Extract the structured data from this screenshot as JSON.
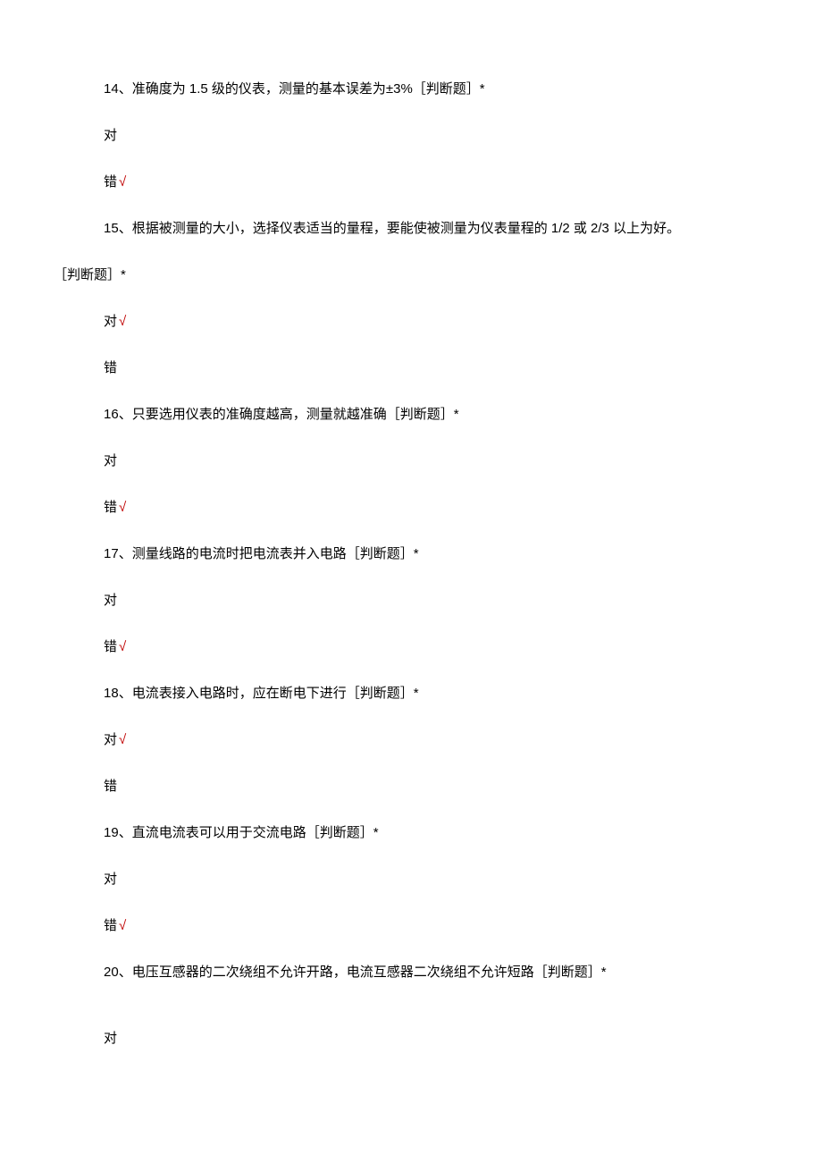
{
  "questions": [
    {
      "number": "14",
      "text": "、准确度为 1.5 级的仪表，测量的基本误差为±3%［判断题］*",
      "options": [
        {
          "label": "对",
          "correct": false
        },
        {
          "label": "错",
          "correct": true
        }
      ]
    },
    {
      "number": "15",
      "text_line1": "、根据被测量的大小，选择仪表适当的量程，要能使被测量为仪表量程的 1/2 或 2/3 以上为好。",
      "text_line2": "［判断题］*",
      "options": [
        {
          "label": "对",
          "correct": true
        },
        {
          "label": "错",
          "correct": false
        }
      ]
    },
    {
      "number": "16",
      "text": "、只要选用仪表的准确度越高，测量就越准确［判断题］*",
      "options": [
        {
          "label": "对",
          "correct": false
        },
        {
          "label": "错",
          "correct": true
        }
      ]
    },
    {
      "number": "17",
      "text": "、测量线路的电流时把电流表并入电路［判断题］*",
      "options": [
        {
          "label": "对",
          "correct": false
        },
        {
          "label": "错",
          "correct": true
        }
      ]
    },
    {
      "number": "18",
      "text": "、电流表接入电路时，应在断电下进行［判断题］*",
      "options": [
        {
          "label": "对",
          "correct": true
        },
        {
          "label": "错",
          "correct": false
        }
      ]
    },
    {
      "number": "19",
      "text": "、直流电流表可以用于交流电路［判断题］*",
      "options": [
        {
          "label": "对",
          "correct": false
        },
        {
          "label": "错",
          "correct": true
        }
      ]
    },
    {
      "number": "20",
      "text": "、电压互感器的二次绕组不允许开路，电流互感器二次绕组不允许短路［判断题］*",
      "options": [
        {
          "label": "对",
          "correct": null
        }
      ]
    }
  ],
  "correct_mark": "√"
}
